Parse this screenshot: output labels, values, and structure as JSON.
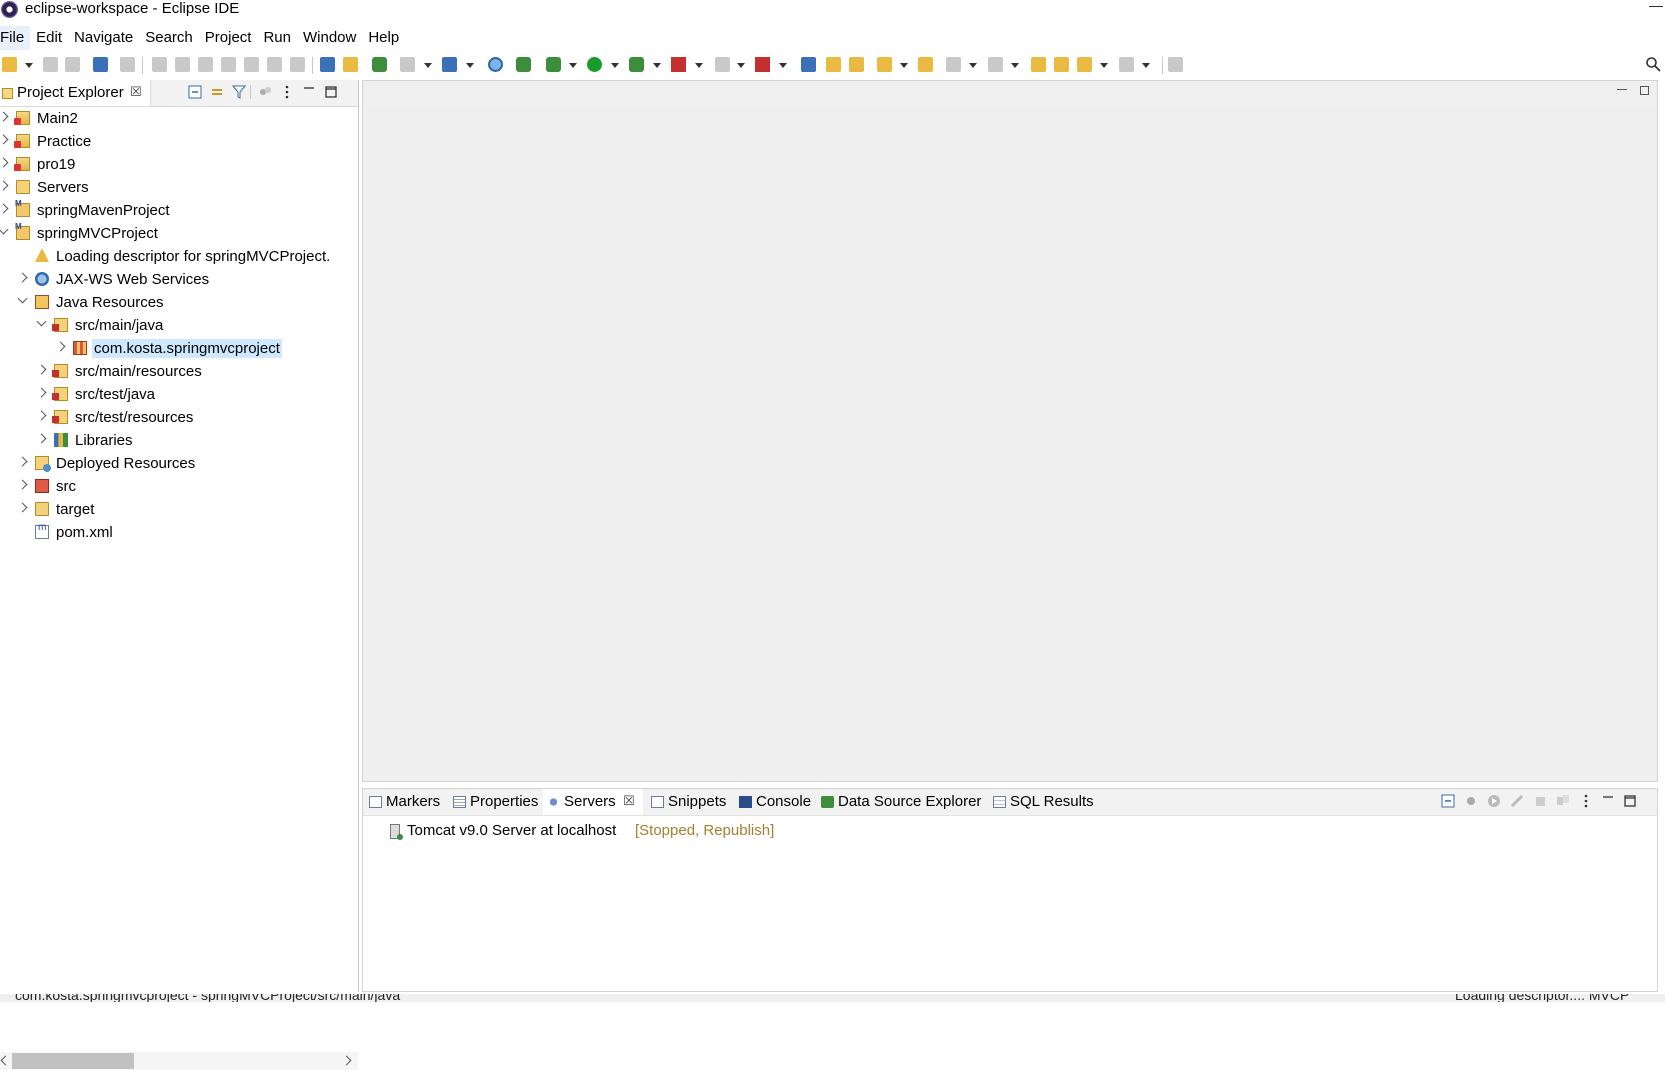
{
  "window": {
    "title": "eclipse-workspace - Eclipse IDE"
  },
  "menubar": {
    "items": [
      "File",
      "Edit",
      "Navigate",
      "Search",
      "Project",
      "Run",
      "Window",
      "Help"
    ]
  },
  "explorer": {
    "tab_label": "Project Explorer",
    "close_glyph": "☒",
    "tree": [
      {
        "label": "Main2",
        "icon": "project-icon",
        "depth": 0,
        "expanded": false
      },
      {
        "label": "Practice",
        "icon": "project-icon",
        "depth": 0,
        "expanded": false
      },
      {
        "label": "pro19",
        "icon": "project-icon",
        "depth": 0,
        "expanded": false
      },
      {
        "label": "Servers",
        "icon": "folder-icon",
        "depth": 0,
        "expanded": false
      },
      {
        "label": "springMavenProject",
        "icon": "maven-project-icon",
        "depth": 0,
        "expanded": false
      },
      {
        "label": "springMVCProject",
        "icon": "maven-project-icon",
        "depth": 0,
        "expanded": true
      },
      {
        "label": "Loading descriptor for springMVCProject.",
        "icon": "loading-icon",
        "depth": 1,
        "expanded": null
      },
      {
        "label": "JAX-WS Web Services",
        "icon": "web-services-icon",
        "depth": 1,
        "expanded": false
      },
      {
        "label": "Java Resources",
        "icon": "java-resources-icon",
        "depth": 1,
        "expanded": true
      },
      {
        "label": "src/main/java",
        "icon": "source-folder-icon",
        "depth": 2,
        "expanded": true
      },
      {
        "label": "com.kosta.springmvcproject",
        "icon": "package-icon",
        "depth": 3,
        "expanded": false,
        "selected": true
      },
      {
        "label": "src/main/resources",
        "icon": "source-folder-icon",
        "depth": 2,
        "expanded": false
      },
      {
        "label": "src/test/java",
        "icon": "source-folder-icon",
        "depth": 2,
        "expanded": false
      },
      {
        "label": "src/test/resources",
        "icon": "source-folder-icon",
        "depth": 2,
        "expanded": false
      },
      {
        "label": "Libraries",
        "icon": "libraries-icon",
        "depth": 2,
        "expanded": false
      },
      {
        "label": "Deployed Resources",
        "icon": "deployed-resources-icon",
        "depth": 1,
        "expanded": false
      },
      {
        "label": "src",
        "icon": "src-folder-icon",
        "depth": 1,
        "expanded": false
      },
      {
        "label": "target",
        "icon": "folder-icon",
        "depth": 1,
        "expanded": false
      },
      {
        "label": "pom.xml",
        "icon": "xml-file-icon",
        "depth": 1,
        "expanded": null
      }
    ]
  },
  "bottom_panel": {
    "tabs": [
      {
        "label": "Markers",
        "icon": "markers-icon"
      },
      {
        "label": "Properties",
        "icon": "properties-icon"
      },
      {
        "label": "Servers",
        "icon": "servers-icon",
        "active": true
      },
      {
        "label": "Snippets",
        "icon": "snippets-icon"
      },
      {
        "label": "Console",
        "icon": "console-icon"
      },
      {
        "label": "Data Source Explorer",
        "icon": "data-source-icon"
      },
      {
        "label": "SQL Results",
        "icon": "sql-results-icon"
      }
    ],
    "close_glyph": "☒",
    "servers": [
      {
        "name": "Tomcat v9.0 Server at localhost",
        "status": "[Stopped, Republish]"
      }
    ]
  },
  "statusbar": {
    "left": "com.kosta.springmvcproject - springMVCProject/src/main/java",
    "right": "Loading descriptor...: MVCP"
  },
  "colors": {
    "selection": "#cde8ff",
    "status_text": "#a57f2e",
    "editor_bg": "#efefef"
  }
}
